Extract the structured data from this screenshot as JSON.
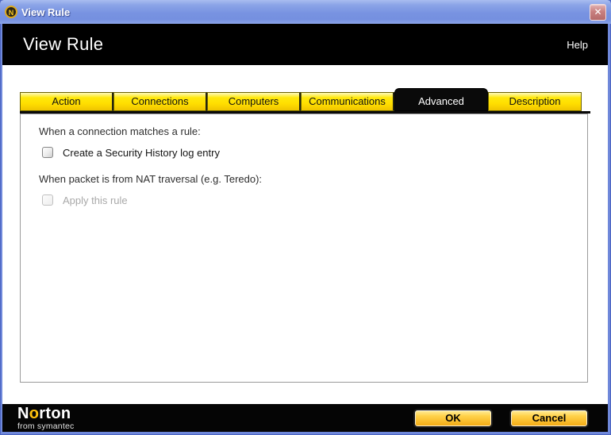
{
  "titlebar": {
    "title": "View Rule"
  },
  "icons": {
    "norton_glyph": "N",
    "close_glyph": "✕"
  },
  "header": {
    "title": "View Rule",
    "help": "Help"
  },
  "tabs": [
    {
      "label": "Action",
      "active": false
    },
    {
      "label": "Connections",
      "active": false
    },
    {
      "label": "Computers",
      "active": false
    },
    {
      "label": "Communications",
      "active": false
    },
    {
      "label": "Advanced",
      "active": true
    },
    {
      "label": "Description",
      "active": false
    }
  ],
  "panel": {
    "section1": "When a connection matches a rule:",
    "checkbox1": {
      "label": "Create a Security History log entry",
      "checked": false
    },
    "section2": "When packet is from NAT traversal (e.g. Teredo):",
    "checkbox2": {
      "label": "Apply this rule",
      "checked": false,
      "disabled": true
    }
  },
  "footer": {
    "brand": {
      "prefix": "N",
      "o": "o",
      "suffix": "rton",
      "tagline": "from symantec"
    },
    "ok": "OK",
    "cancel": "Cancel"
  },
  "colors": {
    "norton_yellow": "#ffde00",
    "titlebar_blue": "#7b96e2",
    "frame_blue": "#6f88da",
    "button_gold": "#f3a912",
    "header_black": "#000000"
  }
}
